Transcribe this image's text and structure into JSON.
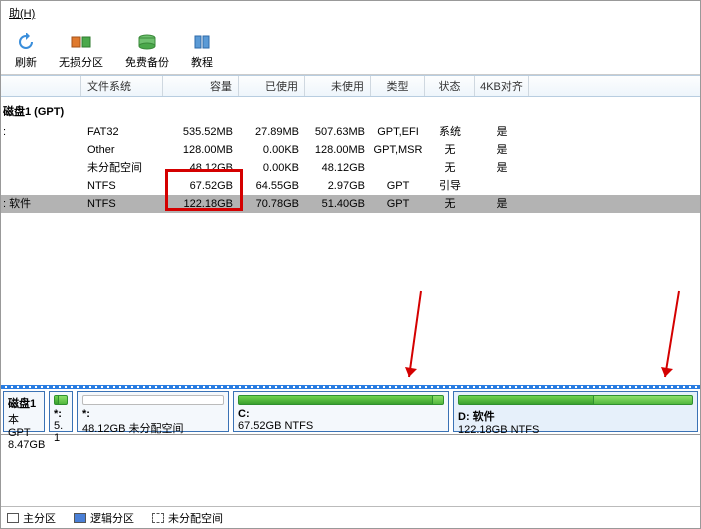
{
  "menu": {
    "help": "助(H)"
  },
  "toolbar": {
    "refresh": "刷新",
    "lossless": "无损分区",
    "backup": "免费备份",
    "tutorial": "教程"
  },
  "columns": {
    "fs": "文件系统",
    "cap": "容量",
    "used": "已使用",
    "unused": "未使用",
    "type": "类型",
    "status": "状态",
    "align": "4KB对齐"
  },
  "group": "磁盘1 (GPT)",
  "rows": [
    {
      "indent": ":",
      "fs": "FAT32",
      "cap": "535.52MB",
      "used": "27.89MB",
      "unused": "507.63MB",
      "type": "GPT,EFI",
      "status": "系统",
      "align": "是"
    },
    {
      "indent": "",
      "fs": "Other",
      "cap": "128.00MB",
      "used": "0.00KB",
      "unused": "128.00MB",
      "type": "GPT,MSR",
      "status": "无",
      "align": "是"
    },
    {
      "indent": "",
      "fs": "未分配空间",
      "cap": "48.12GB",
      "used": "0.00KB",
      "unused": "48.12GB",
      "type": "",
      "status": "无",
      "align": "是"
    },
    {
      "indent": "",
      "fs": "NTFS",
      "cap": "67.52GB",
      "used": "64.55GB",
      "unused": "2.97GB",
      "type": "GPT",
      "status": "引导",
      "align": ""
    },
    {
      "indent": ": 软件",
      "fs": "NTFS",
      "cap": "122.18GB",
      "used": "70.78GB",
      "unused": "51.40GB",
      "type": "GPT",
      "status": "无",
      "align": "是",
      "selected": true
    }
  ],
  "diskmap": {
    "disk": {
      "title": "磁盘1",
      "sub1": "本 GPT",
      "sub2": "8.47GB"
    },
    "p0": {
      "t1": "*:",
      "t2": "5. 1"
    },
    "p1": {
      "t1": "*:",
      "t2": "48.12GB 未分配空间"
    },
    "p2": {
      "t1": "C:",
      "t2": "67.52GB NTFS"
    },
    "p3": {
      "t1": "D: 软件",
      "t2": "122.18GB NTFS"
    }
  },
  "legend": {
    "primary": "主分区",
    "logical": "逻辑分区",
    "unalloc": "未分配空间"
  },
  "colors": {
    "red": "#d40000",
    "green": "#52b83e",
    "blue": "#2a7de1"
  }
}
